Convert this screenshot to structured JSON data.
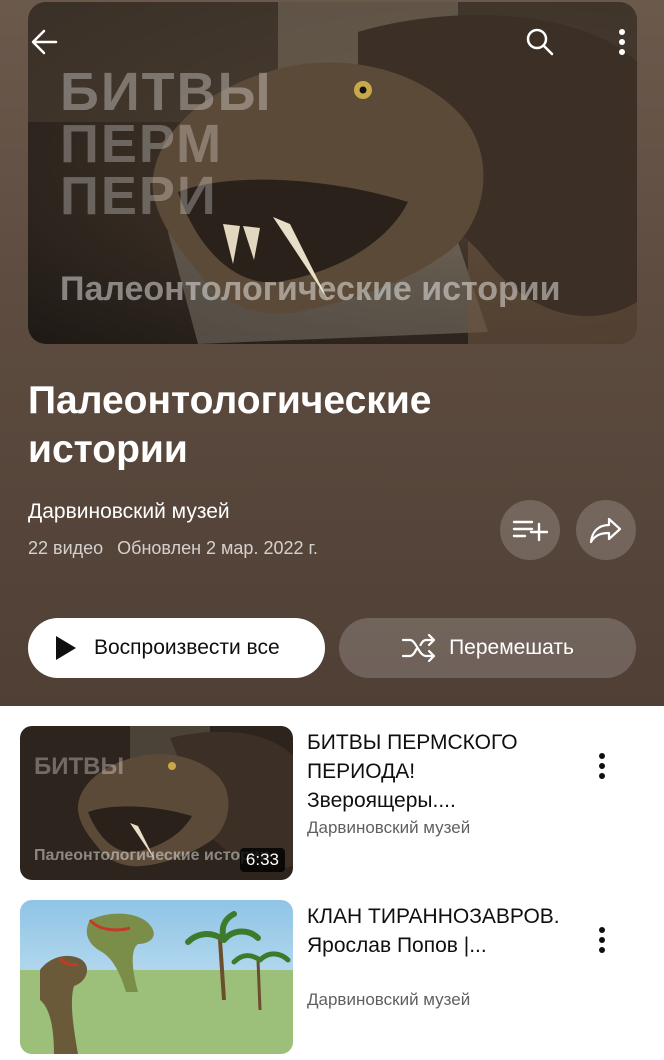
{
  "playlist": {
    "title": "Палеонтологические истории",
    "channel": "Дарвиновский музей",
    "video_count": "22 видео",
    "updated": "Обновлен 2 мар. 2022 г.",
    "cover_text": {
      "big": "БИТВЫ ПЕРМСКОГО ПЕРИОДА",
      "sub": "Палеонтологические истории"
    }
  },
  "top_bar": {
    "back_icon": "arrow-left-icon",
    "search_icon": "search-icon",
    "more_icon": "more-vertical-icon"
  },
  "actions": {
    "add_to_library_icon": "playlist-add-icon",
    "share_icon": "share-icon",
    "play_all_label": "Воспроизвести все",
    "shuffle_label": "Перемешать"
  },
  "videos": [
    {
      "title": "БИТВЫ ПЕРМСКОГО ПЕРИОДА! Звероящеры....",
      "channel": "Дарвиновский музей",
      "duration": "6:33",
      "thumb_text": {
        "big": "БИТВЫ",
        "sub": "Палеонтологические истории"
      }
    },
    {
      "title": "КЛАН ТИРАННОЗАВРОВ. Ярослав Попов |...",
      "channel": "Дарвиновский музей"
    }
  ],
  "colors": {
    "hero_bg": "#5e4c40",
    "button_white": "#ffffff",
    "text_primary": "#0f0f0f",
    "text_secondary": "#606060"
  }
}
